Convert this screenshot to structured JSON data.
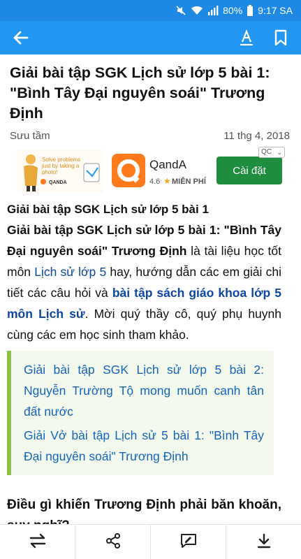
{
  "status_bar": {
    "battery": "80%",
    "time": "9:17 SA",
    "icons": [
      "mute-icon",
      "wifi-icon",
      "signal-icon",
      "battery-icon"
    ]
  },
  "toolbar": {
    "icons": [
      "back-arrow-icon",
      "font-size-icon",
      "bookmark-icon"
    ]
  },
  "article": {
    "title": "Giải bài tập SGK Lịch sử lớp 5 bài 1: \"Bình Tây Đại nguyên soái\" Trương Định",
    "source": "Sưu tầm",
    "date": "11 thg 4, 2018",
    "subheading": "Giải bài tập SGK Lịch sử lớp 5 bài 1",
    "intro_bold": "Giải bài tập SGK Lịch sử lớp 5 bài 1: \"Bình Tây Đại nguyên soái\" Trương Định",
    "intro_text_1": " là tài liệu học tốt môn ",
    "intro_link_1": "Lịch sử lớp 5",
    "intro_text_2": " hay, hướng dẫn các em giải chi tiết các câu hỏi và ",
    "intro_link_2": "bài tập sách giáo khoa lớp 5 môn Lịch sử",
    "intro_text_3": ". Mời quý thầy cô, quý phụ huynh cùng các em học sinh tham khảo.",
    "related": [
      "Giải bài tập SGK Lịch sử lớp 5 bài 2: Nguyễn Trường Tộ mong muốn canh tân đất nước",
      "Giải Vở bài tập Lịch sử 5 bài 1: \"Bình Tây Đại nguyên soái\" Trương Định"
    ],
    "section_heading": "Điều gì khiến Trương Định phải băn khoăn, suy nghĩ?"
  },
  "ad": {
    "banner_text": "Solve problems just by taking a photo!",
    "banner_brand": "QANDA",
    "app_name": "QandA",
    "rating": "4.6",
    "price": "MIỄN PHÍ",
    "install_label": "Cài đặt",
    "badge": "QC"
  },
  "bottom_bar": {
    "icons": [
      "swap-icon",
      "share-icon",
      "comment-icon",
      "download-icon"
    ]
  },
  "colors": {
    "status_bar": "#1e88e5",
    "app_bar": "#2196f3",
    "link": "#0d47a1",
    "related_bg": "#f3f9ec",
    "related_border": "#8bc34a",
    "install_button": "#1e8e3e"
  }
}
